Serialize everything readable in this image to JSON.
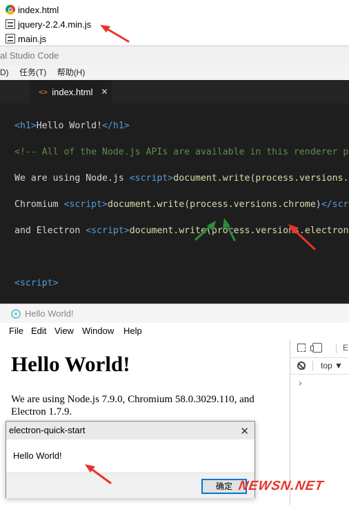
{
  "files": [
    {
      "name": "index.html",
      "icon": "chrome-icon"
    },
    {
      "name": "jquery-2.2.4.min.js",
      "icon": "js-file-icon"
    },
    {
      "name": "main.js",
      "icon": "js-file-icon"
    }
  ],
  "vscode": {
    "title": "al Studio Code",
    "menu": [
      "D)",
      "任务(T)",
      "帮助(H)"
    ],
    "tab": {
      "label": "index.html",
      "close": "✕"
    }
  },
  "electron": {
    "title": "Hello World!",
    "menu": [
      "File",
      "Edit",
      "View",
      "Window",
      "Help"
    ],
    "heading": "Hello World!",
    "paragraph": "We are using Node.js 7.9.0, Chromium 58.0.3029.110, and Electron 1.7.9.",
    "devtools": {
      "elements_tab": "E",
      "context": "top ▼",
      "prompt": "›"
    }
  },
  "dialog": {
    "title": "electron-quick-start",
    "close": "✕",
    "message": "Hello World!",
    "ok_label": "确定"
  },
  "watermark": "NEWSN.NET",
  "colors": {
    "arrow_red": "#e8332b",
    "arrow_green": "#2e8b3a",
    "editor_bg": "#1e1e1e"
  }
}
